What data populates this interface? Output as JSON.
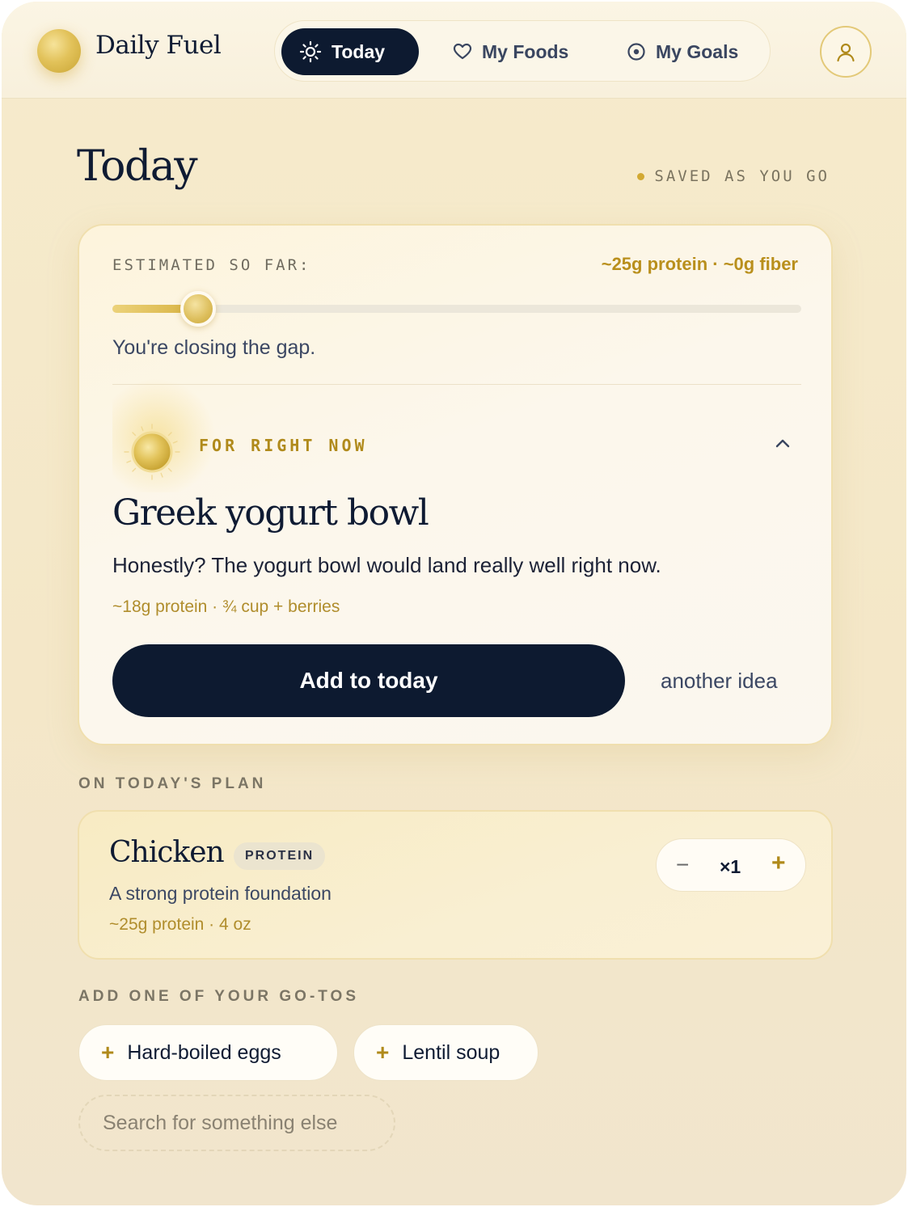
{
  "header": {
    "brand": "Daily Fuel",
    "nav": [
      {
        "label": "Today",
        "icon": "sun-icon",
        "active": true
      },
      {
        "label": "My Foods",
        "icon": "heart-icon",
        "active": false
      },
      {
        "label": "My Goals",
        "icon": "target-icon",
        "active": false
      }
    ],
    "profile_icon": "user-icon"
  },
  "page": {
    "title": "Today",
    "saved_status": "SAVED AS YOU GO"
  },
  "progress_card": {
    "label": "ESTIMATED SO FAR:",
    "values": "~25g protein · ~0g fiber",
    "progress_fraction": 0.12,
    "message": "You're closing the gap."
  },
  "suggestion": {
    "eyebrow": "FOR RIGHT NOW",
    "title": "Greek yogurt bowl",
    "note": "Honestly? The yogurt bowl would land really well right now.",
    "meta": "~18g protein · ¾ cup + berries",
    "primary_label": "Add to today",
    "secondary_label": "another idea"
  },
  "plan": {
    "section_label": "ON TODAY'S PLAN",
    "items": [
      {
        "name": "Chicken",
        "tag": "PROTEIN",
        "description": "A strong protein foundation",
        "meta": "~25g protein · 4 oz",
        "quantity": "×1",
        "minus": "−",
        "plus": "+"
      }
    ]
  },
  "gotos": {
    "section_label": "ADD ONE OF YOUR GO-TOS",
    "items": [
      {
        "label": "Hard-boiled eggs"
      },
      {
        "label": "Lentil soup"
      }
    ],
    "search_placeholder": "Search for something else"
  },
  "colors": {
    "accent_gold": "#b08a1b",
    "navy": "#0d1a30",
    "background": "#f4e7c8"
  }
}
